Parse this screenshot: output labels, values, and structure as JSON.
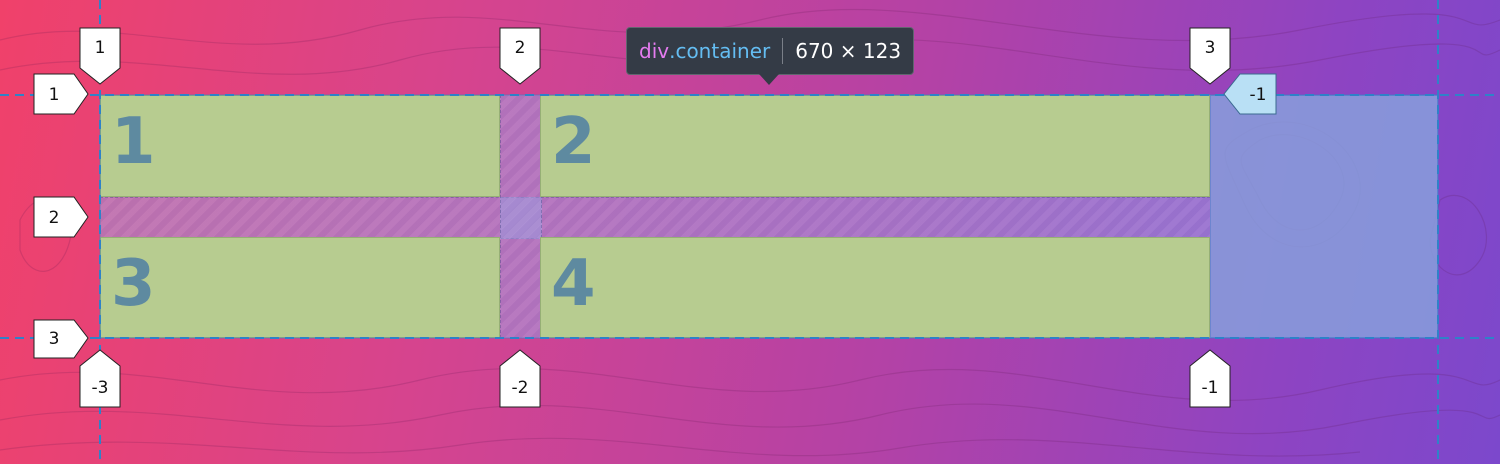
{
  "tooltip": {
    "tag": "div",
    "class_name": ".container",
    "dimensions": "670 × 123"
  },
  "grid_items": [
    {
      "label": "1"
    },
    {
      "label": "2"
    },
    {
      "label": "3"
    },
    {
      "label": "4"
    }
  ],
  "line_badges": {
    "column_top": [
      "1",
      "2",
      "3"
    ],
    "column_bottom": [
      "-3",
      "-2",
      "-1"
    ],
    "row_left": [
      "1",
      "2",
      "3"
    ],
    "row_right": [
      "-1"
    ]
  },
  "colors": {
    "grid_item": "#b7cc90",
    "item_number": "#5e8aa0",
    "gap": "#9aa0dc",
    "implicit_area": "#87a0dc",
    "grid_line": "#2f82c8",
    "tooltip_bg": "#343b46",
    "tooltip_tag": "#e57cf0",
    "tooltip_class": "#64bdf2"
  }
}
